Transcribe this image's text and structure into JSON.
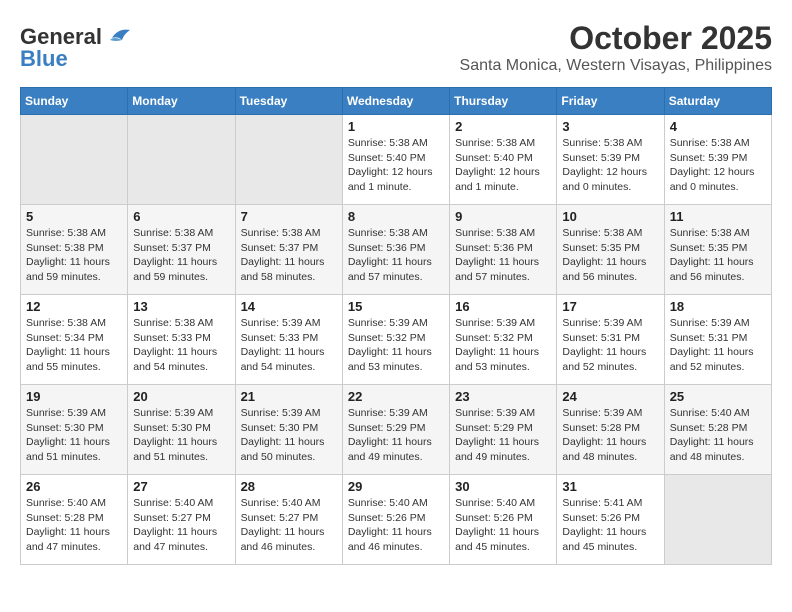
{
  "logo": {
    "line1": "General",
    "line2": "Blue"
  },
  "header": {
    "title": "October 2025",
    "subtitle": "Santa Monica, Western Visayas, Philippines"
  },
  "weekdays": [
    "Sunday",
    "Monday",
    "Tuesday",
    "Wednesday",
    "Thursday",
    "Friday",
    "Saturday"
  ],
  "weeks": [
    [
      {
        "day": "",
        "info": ""
      },
      {
        "day": "",
        "info": ""
      },
      {
        "day": "",
        "info": ""
      },
      {
        "day": "1",
        "info": "Sunrise: 5:38 AM\nSunset: 5:40 PM\nDaylight: 12 hours\nand 1 minute."
      },
      {
        "day": "2",
        "info": "Sunrise: 5:38 AM\nSunset: 5:40 PM\nDaylight: 12 hours\nand 1 minute."
      },
      {
        "day": "3",
        "info": "Sunrise: 5:38 AM\nSunset: 5:39 PM\nDaylight: 12 hours\nand 0 minutes."
      },
      {
        "day": "4",
        "info": "Sunrise: 5:38 AM\nSunset: 5:39 PM\nDaylight: 12 hours\nand 0 minutes."
      }
    ],
    [
      {
        "day": "5",
        "info": "Sunrise: 5:38 AM\nSunset: 5:38 PM\nDaylight: 11 hours\nand 59 minutes."
      },
      {
        "day": "6",
        "info": "Sunrise: 5:38 AM\nSunset: 5:37 PM\nDaylight: 11 hours\nand 59 minutes."
      },
      {
        "day": "7",
        "info": "Sunrise: 5:38 AM\nSunset: 5:37 PM\nDaylight: 11 hours\nand 58 minutes."
      },
      {
        "day": "8",
        "info": "Sunrise: 5:38 AM\nSunset: 5:36 PM\nDaylight: 11 hours\nand 57 minutes."
      },
      {
        "day": "9",
        "info": "Sunrise: 5:38 AM\nSunset: 5:36 PM\nDaylight: 11 hours\nand 57 minutes."
      },
      {
        "day": "10",
        "info": "Sunrise: 5:38 AM\nSunset: 5:35 PM\nDaylight: 11 hours\nand 56 minutes."
      },
      {
        "day": "11",
        "info": "Sunrise: 5:38 AM\nSunset: 5:35 PM\nDaylight: 11 hours\nand 56 minutes."
      }
    ],
    [
      {
        "day": "12",
        "info": "Sunrise: 5:38 AM\nSunset: 5:34 PM\nDaylight: 11 hours\nand 55 minutes."
      },
      {
        "day": "13",
        "info": "Sunrise: 5:38 AM\nSunset: 5:33 PM\nDaylight: 11 hours\nand 54 minutes."
      },
      {
        "day": "14",
        "info": "Sunrise: 5:39 AM\nSunset: 5:33 PM\nDaylight: 11 hours\nand 54 minutes."
      },
      {
        "day": "15",
        "info": "Sunrise: 5:39 AM\nSunset: 5:32 PM\nDaylight: 11 hours\nand 53 minutes."
      },
      {
        "day": "16",
        "info": "Sunrise: 5:39 AM\nSunset: 5:32 PM\nDaylight: 11 hours\nand 53 minutes."
      },
      {
        "day": "17",
        "info": "Sunrise: 5:39 AM\nSunset: 5:31 PM\nDaylight: 11 hours\nand 52 minutes."
      },
      {
        "day": "18",
        "info": "Sunrise: 5:39 AM\nSunset: 5:31 PM\nDaylight: 11 hours\nand 52 minutes."
      }
    ],
    [
      {
        "day": "19",
        "info": "Sunrise: 5:39 AM\nSunset: 5:30 PM\nDaylight: 11 hours\nand 51 minutes."
      },
      {
        "day": "20",
        "info": "Sunrise: 5:39 AM\nSunset: 5:30 PM\nDaylight: 11 hours\nand 51 minutes."
      },
      {
        "day": "21",
        "info": "Sunrise: 5:39 AM\nSunset: 5:30 PM\nDaylight: 11 hours\nand 50 minutes."
      },
      {
        "day": "22",
        "info": "Sunrise: 5:39 AM\nSunset: 5:29 PM\nDaylight: 11 hours\nand 49 minutes."
      },
      {
        "day": "23",
        "info": "Sunrise: 5:39 AM\nSunset: 5:29 PM\nDaylight: 11 hours\nand 49 minutes."
      },
      {
        "day": "24",
        "info": "Sunrise: 5:39 AM\nSunset: 5:28 PM\nDaylight: 11 hours\nand 48 minutes."
      },
      {
        "day": "25",
        "info": "Sunrise: 5:40 AM\nSunset: 5:28 PM\nDaylight: 11 hours\nand 48 minutes."
      }
    ],
    [
      {
        "day": "26",
        "info": "Sunrise: 5:40 AM\nSunset: 5:28 PM\nDaylight: 11 hours\nand 47 minutes."
      },
      {
        "day": "27",
        "info": "Sunrise: 5:40 AM\nSunset: 5:27 PM\nDaylight: 11 hours\nand 47 minutes."
      },
      {
        "day": "28",
        "info": "Sunrise: 5:40 AM\nSunset: 5:27 PM\nDaylight: 11 hours\nand 46 minutes."
      },
      {
        "day": "29",
        "info": "Sunrise: 5:40 AM\nSunset: 5:26 PM\nDaylight: 11 hours\nand 46 minutes."
      },
      {
        "day": "30",
        "info": "Sunrise: 5:40 AM\nSunset: 5:26 PM\nDaylight: 11 hours\nand 45 minutes."
      },
      {
        "day": "31",
        "info": "Sunrise: 5:41 AM\nSunset: 5:26 PM\nDaylight: 11 hours\nand 45 minutes."
      },
      {
        "day": "",
        "info": ""
      }
    ]
  ]
}
